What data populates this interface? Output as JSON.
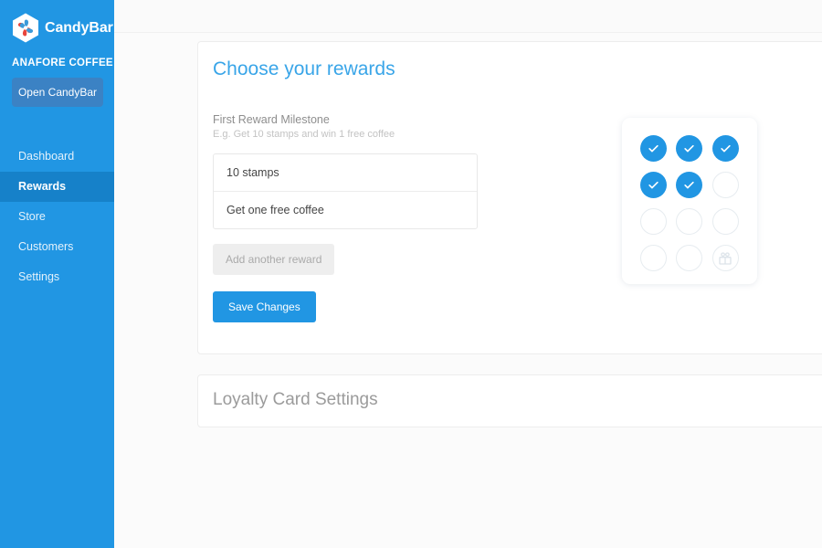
{
  "sidebar": {
    "brand_name": "CandyBar",
    "logo_icon": "candybar-pinwheel-logo",
    "store_name": "ANAFORE COFFEE",
    "open_button_label": "Open CandyBar",
    "nav_items": [
      {
        "label": "Dashboard",
        "active": false
      },
      {
        "label": "Rewards",
        "active": true
      },
      {
        "label": "Store",
        "active": false
      },
      {
        "label": "Customers",
        "active": false
      },
      {
        "label": "Settings",
        "active": false
      }
    ]
  },
  "rewards_card": {
    "title": "Choose your rewards",
    "field_label": "First Reward Milestone",
    "field_hint": "E.g. Get 10 stamps and win 1 free coffee",
    "stamps_value": "10 stamps",
    "stamps_placeholder": "10 stamps",
    "reward_value": "Get one free coffee",
    "reward_placeholder": "Get one free coffee",
    "add_button_label": "Add another reward",
    "save_button_label": "Save Changes"
  },
  "stamp_card_preview": {
    "total_stamps": 12,
    "collected_stamps": 5,
    "columns": 3,
    "rows": 4,
    "reward_slot_index": 11,
    "reward_icon": "gift-icon",
    "stamp_icon": "check-icon",
    "stamps": [
      "filled",
      "filled",
      "filled",
      "filled",
      "filled",
      "empty",
      "empty",
      "empty",
      "empty",
      "empty",
      "empty",
      "reward"
    ]
  },
  "loyalty_card": {
    "title": "Loyalty Card Settings"
  },
  "colors": {
    "sidebar_blue": "#2196e3",
    "sidebar_active_blue": "#1681c9",
    "open_button_blue": "#3b82c4",
    "title_blue": "#39a5e8",
    "primary_button_blue": "#2196e3",
    "muted_text": "#9b9b9b",
    "page_background": "#fbfbfb"
  }
}
